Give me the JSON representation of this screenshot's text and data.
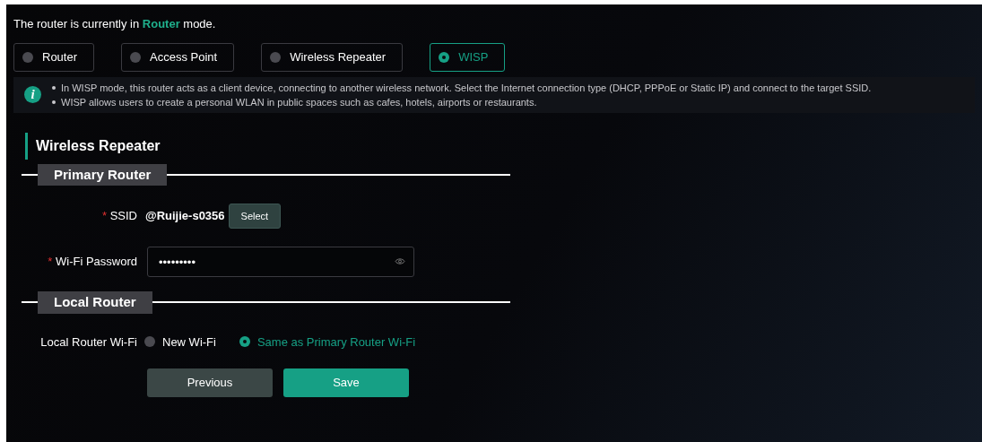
{
  "status": {
    "prefix": "The router is currently in",
    "mode": "Router",
    "suffix": "mode."
  },
  "modes": [
    {
      "label": "Router",
      "selected": false
    },
    {
      "label": "Access Point",
      "selected": false
    },
    {
      "label": "Wireless Repeater",
      "selected": false
    },
    {
      "label": "WISP",
      "selected": true
    }
  ],
  "info_icon": "i",
  "info": [
    "In WISP mode, this router acts as a client device, connecting to another wireless network. Select the Internet connection type (DHCP, PPPoE or Static IP) and connect to the target SSID.",
    "WISP allows users to create a personal WLAN in public spaces such as cafes, hotels, airports or restaurants."
  ],
  "section_title": "Wireless Repeater",
  "primary": {
    "legend": "Primary Router",
    "required_mark": "*",
    "ssid_label": "SSID",
    "ssid_value": "@Ruijie-s0356",
    "select_button": "Select",
    "password_label": "Wi-Fi Password",
    "password_value": "•••••••••"
  },
  "local": {
    "legend": "Local Router",
    "wifi_label": "Local Router Wi-Fi",
    "options": [
      {
        "label": "New Wi-Fi",
        "selected": false
      },
      {
        "label": "Same as Primary Router Wi-Fi",
        "selected": true
      }
    ]
  },
  "buttons": {
    "previous": "Previous",
    "save": "Save"
  }
}
